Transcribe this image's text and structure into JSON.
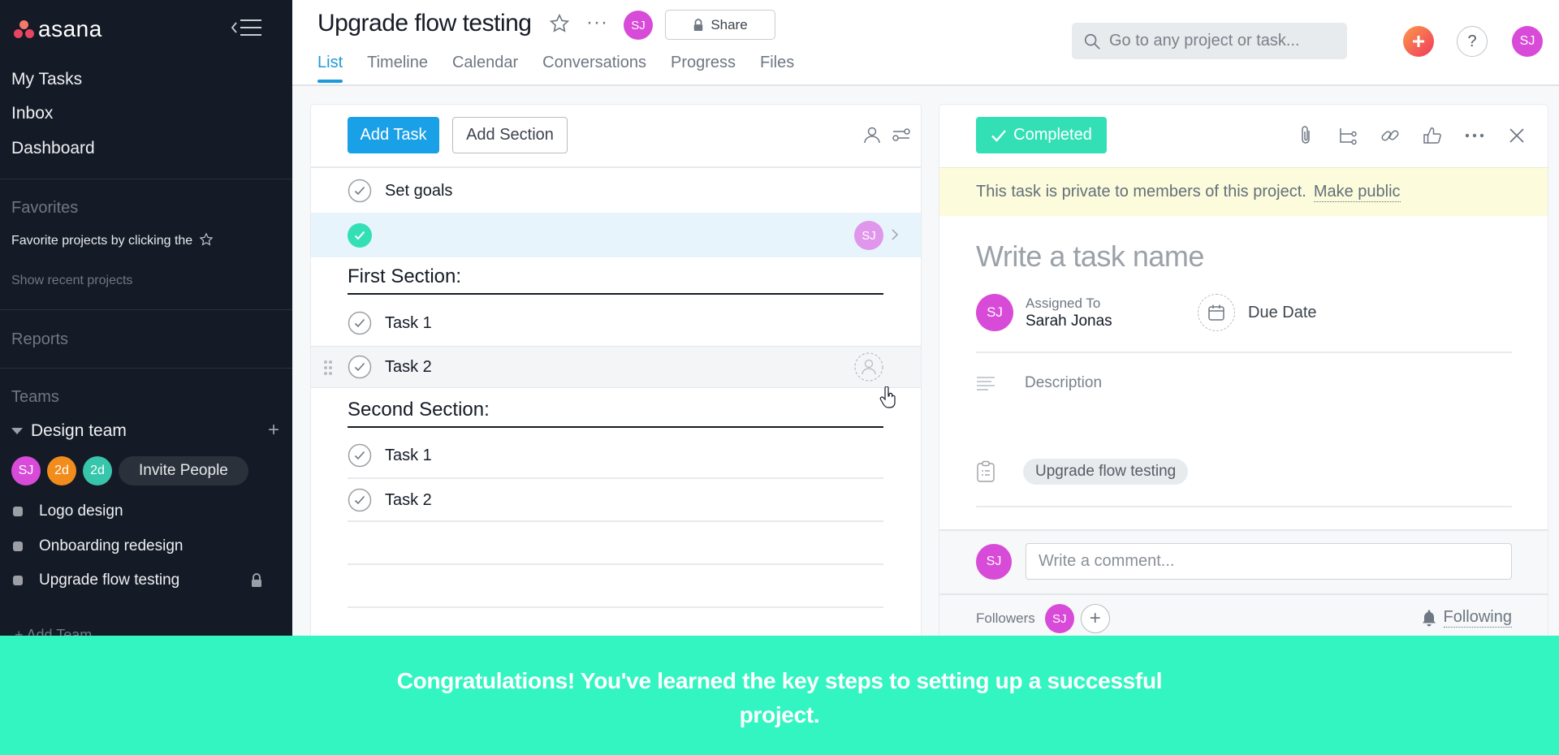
{
  "sidebar": {
    "logo_text": "asana",
    "nav": [
      "My Tasks",
      "Inbox",
      "Dashboard"
    ],
    "favorites_heading": "Favorites",
    "favorites_hint": "Favorite projects by clicking the",
    "show_recent": "Show recent projects",
    "reports_heading": "Reports",
    "teams_heading": "Teams",
    "team": {
      "name": "Design team",
      "members": [
        {
          "initials": "SJ",
          "color": "#d84ad8"
        },
        {
          "initials": "2d",
          "color": "#f28c1c"
        },
        {
          "initials": "2d",
          "color": "#37c5ab"
        }
      ],
      "invite_label": "Invite People",
      "projects": [
        {
          "name": "Logo design",
          "locked": false
        },
        {
          "name": "Onboarding redesign",
          "locked": false
        },
        {
          "name": "Upgrade flow testing",
          "locked": true
        }
      ]
    },
    "add_team": "+ Add Team"
  },
  "header": {
    "project_title": "Upgrade flow testing",
    "owner_initials": "SJ",
    "share_label": "Share",
    "tabs": [
      {
        "label": "List",
        "active": true
      },
      {
        "label": "Timeline",
        "active": false
      },
      {
        "label": "Calendar",
        "active": false
      },
      {
        "label": "Conversations",
        "active": false
      },
      {
        "label": "Progress",
        "active": false
      },
      {
        "label": "Files",
        "active": false
      }
    ],
    "search_placeholder": "Go to any project or task...",
    "user_initials": "SJ"
  },
  "list": {
    "add_task_label": "Add Task",
    "add_section_label": "Add Section",
    "tasks_top": [
      {
        "name": "Set goals",
        "completed": false
      },
      {
        "name": "",
        "completed": true,
        "assignee": "SJ",
        "selected": true
      }
    ],
    "sections": [
      {
        "title": "First Section:",
        "tasks": [
          {
            "name": "Task 1",
            "completed": false
          },
          {
            "name": "Task 2",
            "completed": false,
            "hover": true
          }
        ]
      },
      {
        "title": "Second Section:",
        "tasks": [
          {
            "name": "Task 1",
            "completed": false
          },
          {
            "name": "Task 2",
            "completed": false
          }
        ]
      }
    ]
  },
  "detail": {
    "completed_label": "Completed",
    "private_notice": "This task is private to members of this project.",
    "make_public": "Make public",
    "task_name_placeholder": "Write a task name",
    "assigned_to_label": "Assigned To",
    "assignee_name": "Sarah Jonas",
    "assignee_initials": "SJ",
    "due_date_label": "Due Date",
    "description_placeholder": "Description",
    "project_tag": "Upgrade flow testing",
    "comment_placeholder": "Write a comment...",
    "followers_label": "Followers",
    "follower_initials": "SJ",
    "following_label": "Following"
  },
  "overlay": {
    "message": "Congratulations! You've learned the key steps to setting up a successful project."
  },
  "colors": {
    "sidebar_bg": "#151b26",
    "accent_blue": "#1aa0e6",
    "completed_green": "#33e0b6",
    "overlay_green": "#33f5c2",
    "avatar_magenta": "#d84ad8"
  }
}
